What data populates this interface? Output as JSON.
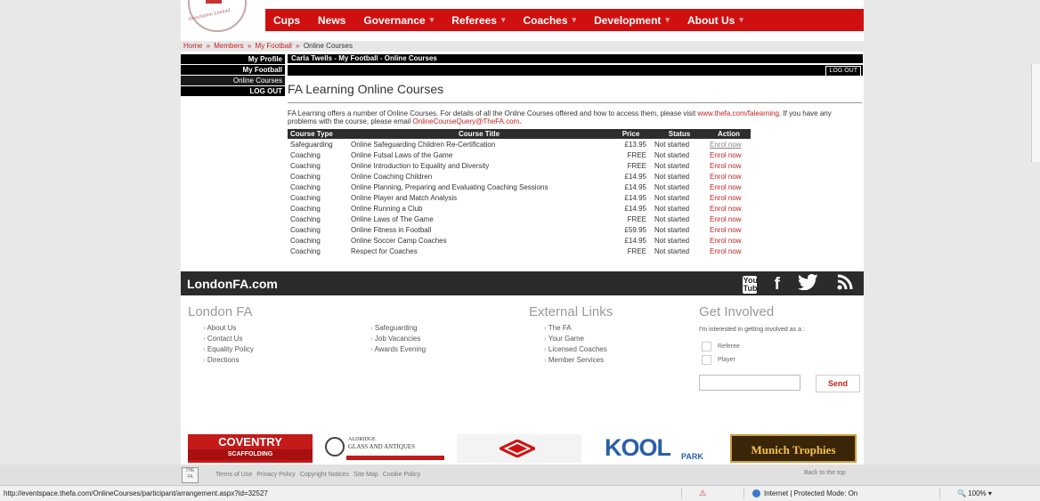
{
  "logo": {
    "text": "Association Limited"
  },
  "nav": {
    "items": [
      {
        "label": "Cups",
        "dropdown": false
      },
      {
        "label": "News",
        "dropdown": false
      },
      {
        "label": "Governance",
        "dropdown": true
      },
      {
        "label": "Referees",
        "dropdown": true
      },
      {
        "label": "Coaches",
        "dropdown": true
      },
      {
        "label": "Development",
        "dropdown": true
      },
      {
        "label": "About Us",
        "dropdown": true
      }
    ],
    "dropdown_glyph": "▾"
  },
  "breadcrumb": {
    "home": "Home",
    "members": "Members",
    "myfootball": "My Football",
    "current": "Online Courses",
    "sep": "»"
  },
  "sidebar": {
    "my_profile": "My Profile",
    "my_football": "My Football",
    "online_courses": "Online Courses",
    "logout": "LOG OUT"
  },
  "userbar": {
    "text": "Carla Twells - My Football - Online Courses"
  },
  "logout_button": "LOG OUT",
  "page_title": "FA Learning Online Courses",
  "intro": {
    "text1": "FA Learning offers a number of Online Courses. For details of all the Online Courses offered and how to access them, please visit",
    "link1": "www.thefa.com/falearning",
    "text2": ". If you have any problems with the course, please email",
    "link2": "OnlineCourseQuery@TheFA.com",
    "text3": "."
  },
  "table": {
    "headers": {
      "type": "Course Type",
      "title": "Course Title",
      "price": "Price",
      "status": "Status",
      "action": "Action"
    },
    "rows": [
      {
        "type": "Safeguarding",
        "title": "Online Safeguarding Children Re-Certification",
        "price": "£13.95",
        "status": "Not started",
        "action": "Enrol now"
      },
      {
        "type": "Coaching",
        "title": "Online Futsal Laws of the Game",
        "price": "FREE",
        "status": "Not started",
        "action": "Enrol now"
      },
      {
        "type": "Coaching",
        "title": "Online Introduction to Equality and Diversity",
        "price": "FREE",
        "status": "Not started",
        "action": "Enrol now"
      },
      {
        "type": "Coaching",
        "title": "Online Coaching Children",
        "price": "£14.95",
        "status": "Not started",
        "action": "Enrol now"
      },
      {
        "type": "Coaching",
        "title": "Online Planning, Preparing and Evaluating Coaching Sessions",
        "price": "£14.95",
        "status": "Not started",
        "action": "Enrol now"
      },
      {
        "type": "Coaching",
        "title": "Online Player and Match Analysis",
        "price": "£14.95",
        "status": "Not started",
        "action": "Enrol now"
      },
      {
        "type": "Coaching",
        "title": "Online Running a Club",
        "price": "£14.95",
        "status": "Not started",
        "action": "Enrol now"
      },
      {
        "type": "Coaching",
        "title": "Online Laws of The Game",
        "price": "FREE",
        "status": "Not started",
        "action": "Enrol now"
      },
      {
        "type": "Coaching",
        "title": "Online Fitness in Football",
        "price": "£59.95",
        "status": "Not started",
        "action": "Enrol now"
      },
      {
        "type": "Coaching",
        "title": "Online Soccer Camp Coaches",
        "price": "£14.95",
        "status": "Not started",
        "action": "Enrol now"
      },
      {
        "type": "Coaching",
        "title": "Respect for Coaches",
        "price": "FREE",
        "status": "Not started",
        "action": "Enrol now"
      }
    ]
  },
  "footer": {
    "brand": "LondonFA.com",
    "social": {
      "youtube": "You Tube",
      "facebook": "f",
      "twitter": "🐦",
      "rss": "〰"
    },
    "london_fa": {
      "heading": "London FA",
      "col1": [
        "About Us",
        "Contact Us",
        "Equality Policy",
        "Directions"
      ],
      "col2": [
        "Safeguarding",
        "Job Vacancies",
        "Awards Evening"
      ]
    },
    "external": {
      "heading": "External Links",
      "links": [
        "The FA",
        "Your Game",
        "Licensed Coaches",
        "Member Services"
      ]
    },
    "get_involved": {
      "heading": "Get Involved",
      "note": "I'm interested in getting involved as a :",
      "options": [
        "Referee",
        "Player"
      ],
      "send": "Send"
    }
  },
  "sponsors": {
    "coventry": {
      "line1": "COVENTRY",
      "line2": "SCAFFOLDING"
    },
    "aldridge": {
      "line1": "ALDRIDGE",
      "line2": "GLASS AND ANTIQUES"
    },
    "kool": {
      "text": "KOOL",
      "sub": "PARK"
    },
    "munich": {
      "text": "Munich Trophies"
    }
  },
  "bottom_links": [
    "Terms of Use",
    "Privacy Policy",
    "Copyright Notices",
    "Site Map",
    "Cookie Policy"
  ],
  "fa_badge": "THE FA",
  "back_to_top": "Back to the top",
  "statusbar": {
    "url": "http://eventspace.thefa.com/OnlineCourses/participant/arrangement.aspx?id=32527",
    "zone": "Internet | Protected Mode: On",
    "zoom": "100%",
    "zoom_icon": "🔍"
  },
  "colors": {
    "nav_red": "#d01010",
    "link_red": "#c81e1e",
    "dark_bar": "#2b2b2b"
  }
}
